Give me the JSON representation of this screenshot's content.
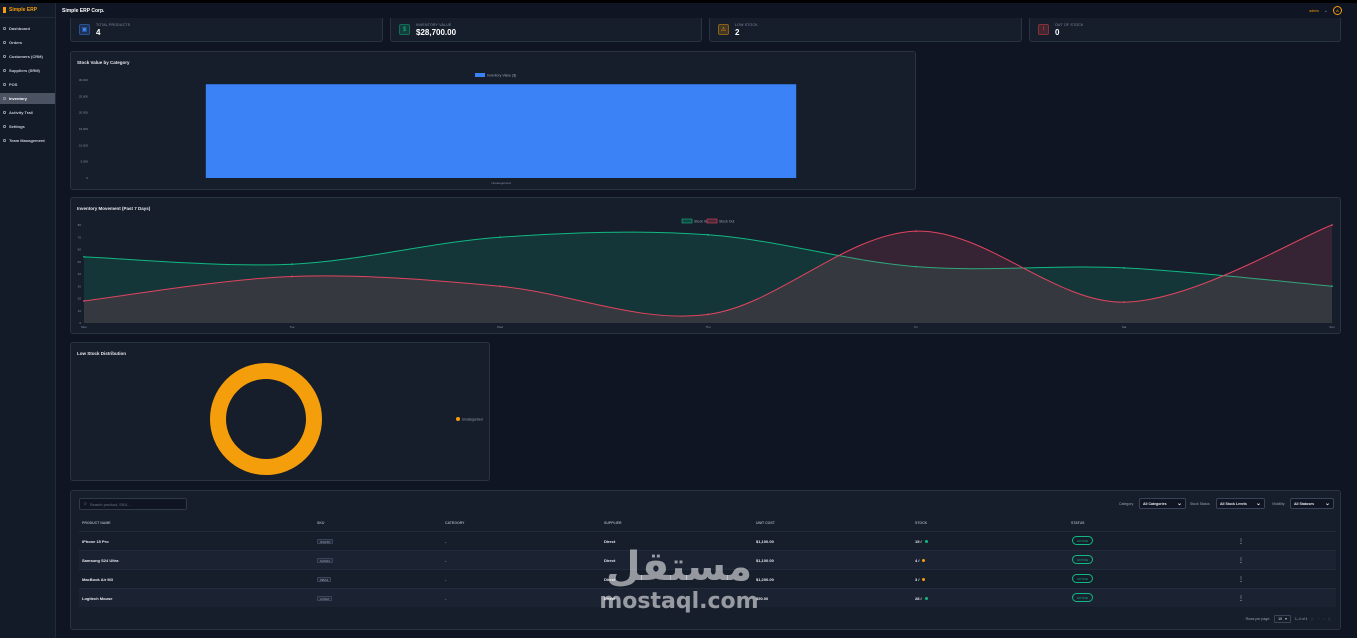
{
  "app": {
    "brand": "Simple ERP",
    "company": "Simple ERP Corp.",
    "user": "admin",
    "avatar": "A"
  },
  "sidebar": {
    "items": [
      {
        "label": "Dashboard",
        "active": false
      },
      {
        "label": "Orders",
        "active": false
      },
      {
        "label": "Customers (CRM)",
        "active": false
      },
      {
        "label": "Suppliers (SRM)",
        "active": false
      },
      {
        "label": "POS",
        "active": false
      },
      {
        "label": "Inventory",
        "active": true
      },
      {
        "label": "Activity Trail",
        "active": false
      },
      {
        "label": "Settings",
        "active": false
      },
      {
        "label": "Team Management",
        "active": false
      }
    ]
  },
  "stats": [
    {
      "label": "TOTAL PRODUCTS",
      "value": "4",
      "color": "#3b82f6",
      "icon": "box-icon"
    },
    {
      "label": "INVENTORY VALUE",
      "value": "$28,700.00",
      "color": "#10b981",
      "icon": "dollar-icon"
    },
    {
      "label": "LOW STOCK",
      "value": "2",
      "color": "#f59e0b",
      "icon": "warning-icon"
    },
    {
      "label": "OUT OF STOCK",
      "value": "0",
      "color": "#ef4444",
      "icon": "alert-icon"
    }
  ],
  "charts": {
    "stock_value": {
      "title": "Stock Value by Category",
      "chart_data": {
        "type": "bar",
        "categories": [
          "Uncategorized"
        ],
        "series": [
          {
            "name": "Inventory Value ($)",
            "values": [
              28700
            ]
          }
        ],
        "ylim": [
          0,
          30000
        ],
        "yticks": [
          "30,000",
          "25,000",
          "20,000",
          "15,000",
          "10,000",
          "5,000",
          "0"
        ],
        "color": "#3b82f6",
        "legend": "top"
      }
    },
    "movement": {
      "title": "Inventory Movement (Past 7 Days)",
      "chart_data": {
        "type": "area",
        "categories": [
          "Mon",
          "Tue",
          "Wed",
          "Thu",
          "Fri",
          "Sat",
          "Sun"
        ],
        "series": [
          {
            "name": "Stock In",
            "values": [
              54,
              48,
              70,
              72,
              46,
              45,
              30
            ],
            "color": "#10b981"
          },
          {
            "name": "Stock Out",
            "values": [
              18,
              38,
              30,
              7,
              75,
              17,
              80
            ],
            "color": "#e0445f"
          }
        ],
        "ylim": [
          0,
          80
        ],
        "yticks": [
          "80",
          "70",
          "60",
          "50",
          "40",
          "30",
          "20",
          "10",
          "0"
        ],
        "legend": "top"
      }
    },
    "low_stock": {
      "title": "Low Stock Distribution",
      "chart_data": {
        "type": "pie",
        "labels": [
          "Uncategorized"
        ],
        "values": [
          2
        ],
        "color": "#f59e0b",
        "legend": "right"
      }
    }
  },
  "table": {
    "search_placeholder": "Search product, SKU...",
    "filters": [
      {
        "label": "Category",
        "value": "All Categories"
      },
      {
        "label": "Stock Status",
        "value": "All Stock Levels"
      },
      {
        "label": "Visibility",
        "value": "All Statuses"
      }
    ],
    "columns": [
      "PRODUCT NAME",
      "SKU",
      "CATEGORY",
      "SUPPLIER",
      "UNIT COST",
      "STOCK",
      "STATUS"
    ],
    "rows": [
      {
        "name": "iPhone 15 Pro",
        "sku": "IPH15P",
        "category": "-",
        "supplier": "Direct",
        "cost": "$1,100.00",
        "stock": "15 /",
        "dot": "#10b981",
        "status": "ACTIVE"
      },
      {
        "name": "Samsung S24 Ultra",
        "sku": "SAM24",
        "category": "-",
        "supplier": "Direct",
        "cost": "$1,100.00",
        "stock": "4 /",
        "dot": "#f59e0b",
        "status": "ACTIVE"
      },
      {
        "name": "MacBook Air M3",
        "sku": "MBA3",
        "category": "-",
        "supplier": "Direct",
        "cost": "$1,200.00",
        "stock": "3 /",
        "dot": "#f59e0b",
        "status": "ACTIVE"
      },
      {
        "name": "Logitech Mouse",
        "sku": "LOGM",
        "category": "-",
        "supplier": "Direct",
        "cost": "$50.00",
        "stock": "28 /",
        "dot": "#10b981",
        "status": "ACTIVE"
      }
    ],
    "pagination": {
      "rows_label": "Rows per page:",
      "rows_value": "10",
      "range": "1–4 of 4"
    }
  },
  "watermark": {
    "arabic": "مستقل",
    "latin": "mostaql.com"
  }
}
